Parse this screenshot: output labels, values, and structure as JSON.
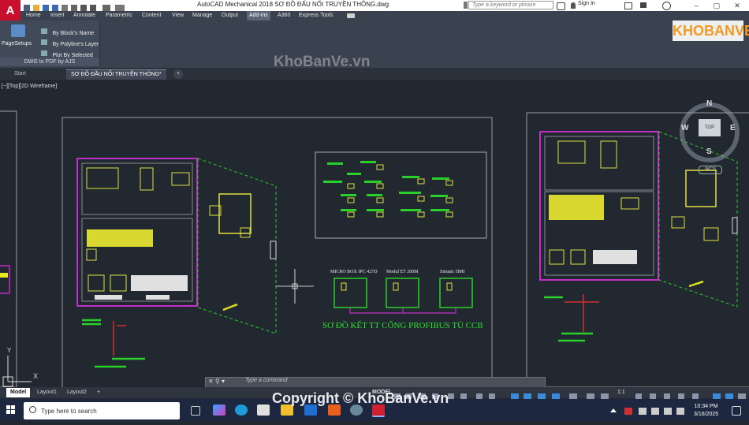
{
  "app": {
    "logo_letter": "A",
    "title": "AutoCAD Mechanical 2018    SƠ ĐỒ ĐẤU NỐI TRUYỀN THÔNG.dwg",
    "search_placeholder": "Type a keyword or phrase",
    "signin_label": "Sign In"
  },
  "ribbon": {
    "tabs": [
      "Home",
      "Insert",
      "Annotate",
      "Parametric",
      "Content",
      "View",
      "Manage",
      "Output",
      "Add-ins",
      "A360",
      "Express Tools"
    ],
    "active_tab": "Add-ins",
    "page_setups_label": "PageSetups",
    "commands": [
      "By Block's Name",
      "By Polyline's Layer",
      "Plot By Selected"
    ],
    "panel_title": "DWG to PDF by AJS"
  },
  "file_tabs": {
    "start": "Start",
    "active": "SƠ ĐỒ ĐẦU NỐI TRUYỀN THÔNG*",
    "add": "+"
  },
  "viewport": {
    "label": "[−][Top][2D Wireframe]"
  },
  "drawing": {
    "device_labels": [
      "MICRO BOX IPC 427D",
      "Modul ET 200M",
      "Simatic HMI"
    ],
    "caption": "SƠ ĐỒ KẾT TT CỔNG PROFIBUS TỦ CCB",
    "ucs_x": "X",
    "ucs_y": "Y"
  },
  "viewcube": {
    "top_face": "TOP",
    "north": "N",
    "south": "S",
    "east": "E",
    "west": "W",
    "wcs": "WCS"
  },
  "command_line": {
    "placeholder": "Type a command"
  },
  "layout_tabs": [
    "Model",
    "Layout1",
    "Layout2"
  ],
  "layout_add": "+",
  "status": {
    "model_label": "MODEL",
    "scale": "1:1"
  },
  "watermarks": {
    "top": "KhoBanVe.vn",
    "bottom": "Copyright © KhoBanVe.vn",
    "brand": "KHOBANVE"
  },
  "taskbar": {
    "search_placeholder": "Type here to search",
    "time": "10:34 PM",
    "date": "3/16/2025"
  }
}
